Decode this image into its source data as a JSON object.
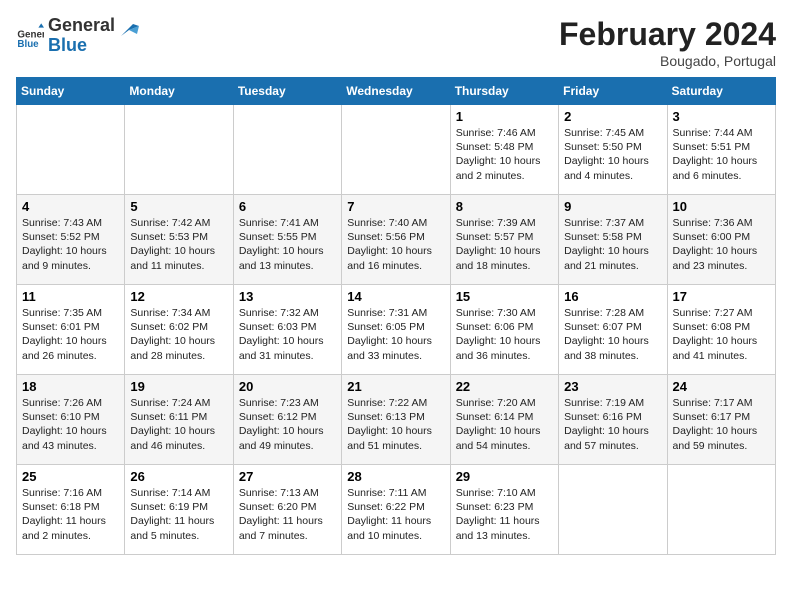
{
  "header": {
    "logo_general": "General",
    "logo_blue": "Blue",
    "month_title": "February 2024",
    "location": "Bougado, Portugal"
  },
  "weekdays": [
    "Sunday",
    "Monday",
    "Tuesday",
    "Wednesday",
    "Thursday",
    "Friday",
    "Saturday"
  ],
  "weeks": [
    [
      {
        "day": "",
        "info": ""
      },
      {
        "day": "",
        "info": ""
      },
      {
        "day": "",
        "info": ""
      },
      {
        "day": "",
        "info": ""
      },
      {
        "day": "1",
        "info": "Sunrise: 7:46 AM\nSunset: 5:48 PM\nDaylight: 10 hours\nand 2 minutes."
      },
      {
        "day": "2",
        "info": "Sunrise: 7:45 AM\nSunset: 5:50 PM\nDaylight: 10 hours\nand 4 minutes."
      },
      {
        "day": "3",
        "info": "Sunrise: 7:44 AM\nSunset: 5:51 PM\nDaylight: 10 hours\nand 6 minutes."
      }
    ],
    [
      {
        "day": "4",
        "info": "Sunrise: 7:43 AM\nSunset: 5:52 PM\nDaylight: 10 hours\nand 9 minutes."
      },
      {
        "day": "5",
        "info": "Sunrise: 7:42 AM\nSunset: 5:53 PM\nDaylight: 10 hours\nand 11 minutes."
      },
      {
        "day": "6",
        "info": "Sunrise: 7:41 AM\nSunset: 5:55 PM\nDaylight: 10 hours\nand 13 minutes."
      },
      {
        "day": "7",
        "info": "Sunrise: 7:40 AM\nSunset: 5:56 PM\nDaylight: 10 hours\nand 16 minutes."
      },
      {
        "day": "8",
        "info": "Sunrise: 7:39 AM\nSunset: 5:57 PM\nDaylight: 10 hours\nand 18 minutes."
      },
      {
        "day": "9",
        "info": "Sunrise: 7:37 AM\nSunset: 5:58 PM\nDaylight: 10 hours\nand 21 minutes."
      },
      {
        "day": "10",
        "info": "Sunrise: 7:36 AM\nSunset: 6:00 PM\nDaylight: 10 hours\nand 23 minutes."
      }
    ],
    [
      {
        "day": "11",
        "info": "Sunrise: 7:35 AM\nSunset: 6:01 PM\nDaylight: 10 hours\nand 26 minutes."
      },
      {
        "day": "12",
        "info": "Sunrise: 7:34 AM\nSunset: 6:02 PM\nDaylight: 10 hours\nand 28 minutes."
      },
      {
        "day": "13",
        "info": "Sunrise: 7:32 AM\nSunset: 6:03 PM\nDaylight: 10 hours\nand 31 minutes."
      },
      {
        "day": "14",
        "info": "Sunrise: 7:31 AM\nSunset: 6:05 PM\nDaylight: 10 hours\nand 33 minutes."
      },
      {
        "day": "15",
        "info": "Sunrise: 7:30 AM\nSunset: 6:06 PM\nDaylight: 10 hours\nand 36 minutes."
      },
      {
        "day": "16",
        "info": "Sunrise: 7:28 AM\nSunset: 6:07 PM\nDaylight: 10 hours\nand 38 minutes."
      },
      {
        "day": "17",
        "info": "Sunrise: 7:27 AM\nSunset: 6:08 PM\nDaylight: 10 hours\nand 41 minutes."
      }
    ],
    [
      {
        "day": "18",
        "info": "Sunrise: 7:26 AM\nSunset: 6:10 PM\nDaylight: 10 hours\nand 43 minutes."
      },
      {
        "day": "19",
        "info": "Sunrise: 7:24 AM\nSunset: 6:11 PM\nDaylight: 10 hours\nand 46 minutes."
      },
      {
        "day": "20",
        "info": "Sunrise: 7:23 AM\nSunset: 6:12 PM\nDaylight: 10 hours\nand 49 minutes."
      },
      {
        "day": "21",
        "info": "Sunrise: 7:22 AM\nSunset: 6:13 PM\nDaylight: 10 hours\nand 51 minutes."
      },
      {
        "day": "22",
        "info": "Sunrise: 7:20 AM\nSunset: 6:14 PM\nDaylight: 10 hours\nand 54 minutes."
      },
      {
        "day": "23",
        "info": "Sunrise: 7:19 AM\nSunset: 6:16 PM\nDaylight: 10 hours\nand 57 minutes."
      },
      {
        "day": "24",
        "info": "Sunrise: 7:17 AM\nSunset: 6:17 PM\nDaylight: 10 hours\nand 59 minutes."
      }
    ],
    [
      {
        "day": "25",
        "info": "Sunrise: 7:16 AM\nSunset: 6:18 PM\nDaylight: 11 hours\nand 2 minutes."
      },
      {
        "day": "26",
        "info": "Sunrise: 7:14 AM\nSunset: 6:19 PM\nDaylight: 11 hours\nand 5 minutes."
      },
      {
        "day": "27",
        "info": "Sunrise: 7:13 AM\nSunset: 6:20 PM\nDaylight: 11 hours\nand 7 minutes."
      },
      {
        "day": "28",
        "info": "Sunrise: 7:11 AM\nSunset: 6:22 PM\nDaylight: 11 hours\nand 10 minutes."
      },
      {
        "day": "29",
        "info": "Sunrise: 7:10 AM\nSunset: 6:23 PM\nDaylight: 11 hours\nand 13 minutes."
      },
      {
        "day": "",
        "info": ""
      },
      {
        "day": "",
        "info": ""
      }
    ]
  ],
  "colors": {
    "header_bg": "#1a6faf",
    "header_text": "#ffffff",
    "odd_row": "#ffffff",
    "even_row": "#f5f5f5"
  }
}
